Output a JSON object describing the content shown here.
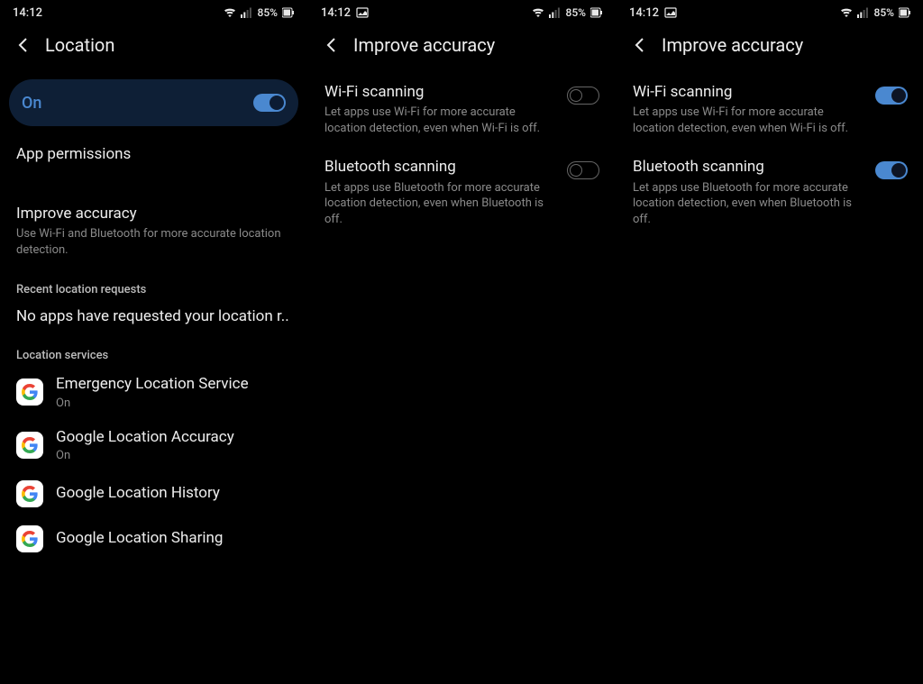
{
  "status": {
    "time": "14:12",
    "battery_percent": "85%"
  },
  "screen1": {
    "title": "Location",
    "master": {
      "label": "On",
      "on": true
    },
    "app_permissions": "App permissions",
    "improve": {
      "title": "Improve accuracy",
      "desc": "Use Wi-Fi and Bluetooth for more accurate location detection."
    },
    "recent_header": "Recent location requests",
    "recent_text": "No apps have requested your location r..",
    "services_header": "Location services",
    "services": [
      {
        "title": "Emergency Location Service",
        "sub": "On"
      },
      {
        "title": "Google Location Accuracy",
        "sub": "On"
      },
      {
        "title": "Google Location History",
        "sub": ""
      },
      {
        "title": "Google Location Sharing",
        "sub": ""
      }
    ]
  },
  "screen2": {
    "title": "Improve accuracy",
    "wifi": {
      "title": "Wi-Fi scanning",
      "desc": "Let apps use Wi-Fi for more accurate location detection, even when Wi-Fi is off.",
      "on": false
    },
    "bt": {
      "title": "Bluetooth scanning",
      "desc": "Let apps use Bluetooth for more accurate location detection, even when Bluetooth is off.",
      "on": false
    }
  },
  "screen3": {
    "title": "Improve accuracy",
    "wifi": {
      "title": "Wi-Fi scanning",
      "desc": "Let apps use Wi-Fi for more accurate location detection, even when Wi-Fi is off.",
      "on": true
    },
    "bt": {
      "title": "Bluetooth scanning",
      "desc": "Let apps use Bluetooth for more accurate location detection, even when Bluetooth is off.",
      "on": true
    }
  }
}
